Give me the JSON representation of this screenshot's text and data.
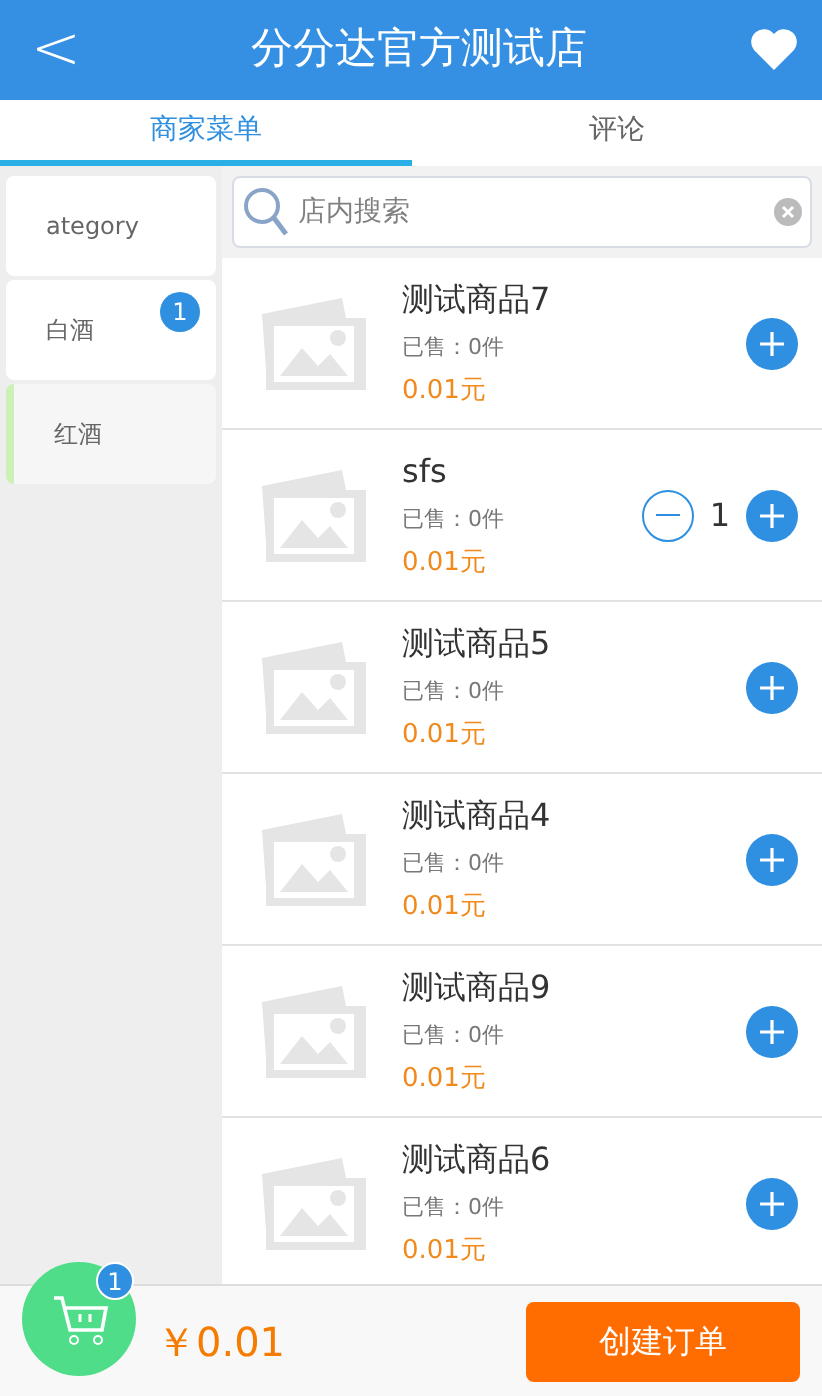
{
  "header": {
    "back": "<",
    "title": "分分达官方测试店"
  },
  "tabs": [
    {
      "label": "商家菜单",
      "selected": true
    },
    {
      "label": "评论",
      "selected": false
    }
  ],
  "categories": [
    {
      "name": "ategory",
      "selected": false
    },
    {
      "name": "白酒",
      "selected": false,
      "badge": "1"
    },
    {
      "name": "红酒",
      "selected": true
    }
  ],
  "search": {
    "placeholder": "店内搜索"
  },
  "products": [
    {
      "name": "测试商品7",
      "sold": "已售：0件",
      "price": "0.01元"
    },
    {
      "name": "sfs",
      "sold": "已售：0件",
      "price": "0.01元",
      "quantity": "1"
    },
    {
      "name": "测试商品5",
      "sold": "已售：0件",
      "price": "0.01元"
    },
    {
      "name": "测试商品4",
      "sold": "已售：0件",
      "price": "0.01元"
    },
    {
      "name": "测试商品9",
      "sold": "已售：0件",
      "price": "0.01元"
    },
    {
      "name": "测试商品6",
      "sold": "已售：0件",
      "price": "0.01元"
    }
  ],
  "cart": {
    "count": "1",
    "total": "￥0.01",
    "checkout": "创建订单"
  }
}
